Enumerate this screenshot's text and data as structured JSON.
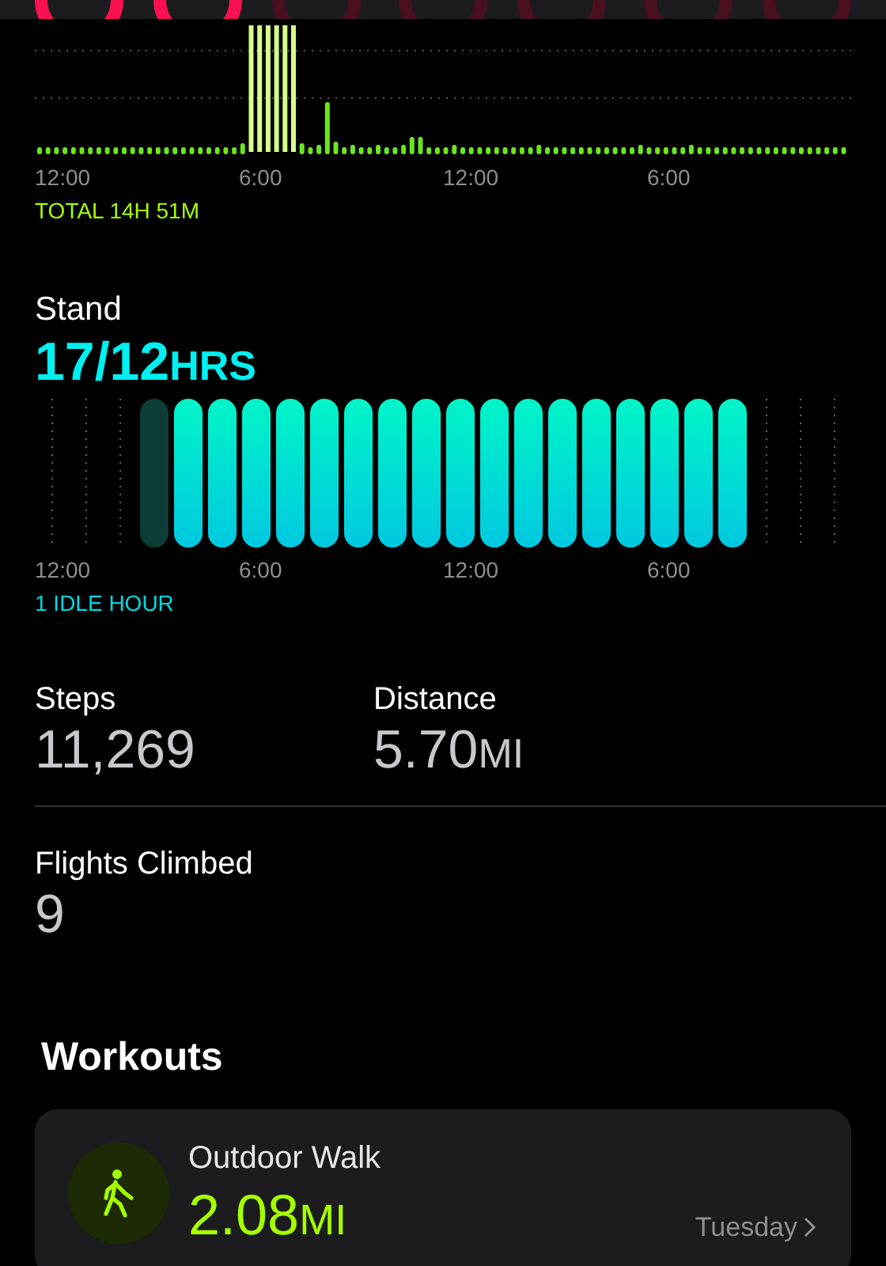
{
  "exercise": {
    "axis_labels": [
      "12:00",
      "6:00",
      "12:00",
      "6:00"
    ],
    "total": "TOTAL 14H 51M"
  },
  "stand": {
    "title": "Stand",
    "value": "17/12",
    "unit": "HRS",
    "axis_labels": [
      "12:00",
      "6:00",
      "12:00",
      "6:00"
    ],
    "summary": "1 IDLE HOUR"
  },
  "metrics": [
    {
      "label": "Steps",
      "value": "11,269"
    },
    {
      "label": "Distance",
      "value": "5.70",
      "unit": "MI"
    }
  ],
  "flights": {
    "label": "Flights Climbed",
    "value": "9"
  },
  "workouts": {
    "title": "Workouts",
    "items": [
      {
        "name": "Outdoor Walk",
        "value": "2.08",
        "unit": "MI",
        "day": "Tuesday"
      }
    ]
  }
}
